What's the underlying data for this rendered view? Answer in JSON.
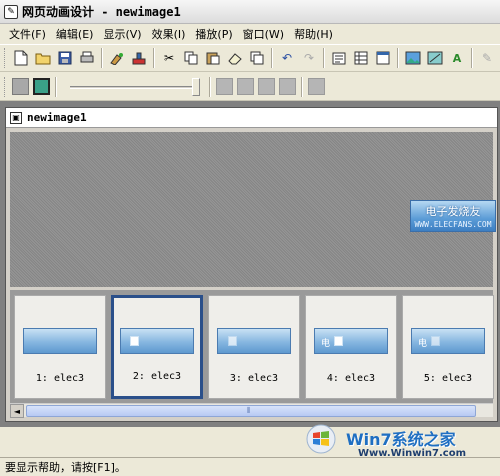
{
  "window": {
    "title": "网页动画设计 - newimage1"
  },
  "menu": [
    "文件(F)",
    "编辑(E)",
    "显示(V)",
    "效果(I)",
    "播放(P)",
    "窗口(W)",
    "帮助(H)"
  ],
  "toolbar1_icons": [
    "new-file-icon",
    "open-folder-icon",
    "save-icon",
    "print-icon",
    "paint-icon",
    "stamp-icon",
    "cut-icon",
    "copy-icon",
    "paste-icon",
    "eraser-icon",
    "layers-icon",
    "undo-icon",
    "redo-icon",
    "properties-icon",
    "table-icon",
    "window-icon",
    "image-icon",
    "image-edit-icon",
    "text-effect-icon",
    "brush-disabled-icon"
  ],
  "document": {
    "title": "newimage1",
    "banner_main": "电子发烧友",
    "banner_sub": "WWW.ELECFANS.COM"
  },
  "frames": [
    {
      "label": "1: elec3"
    },
    {
      "label": "2: elec3"
    },
    {
      "label": "3: elec3"
    },
    {
      "label": "4: elec3"
    },
    {
      "label": "5: elec3"
    }
  ],
  "frame_thumbs": {
    "glyph": "电"
  },
  "scrollbar": {
    "left_arrow": "◄",
    "thumb_mark": "⦀"
  },
  "status": {
    "text": "要显示帮助，请按[F1]。"
  },
  "watermark": {
    "brand": "Win7系统之家",
    "url": "Www.Winwin7.com"
  },
  "colors": {
    "selected_frame": "#2a4f8a",
    "banner": "#5a9bd6",
    "active_button": "#3aa088"
  }
}
